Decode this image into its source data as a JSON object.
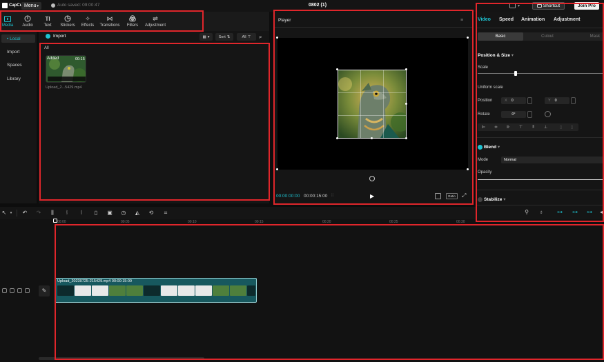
{
  "titlebar": {
    "logo": "CapCut",
    "menu_label": "Menu",
    "autosave": "Auto saved: 09:00:47",
    "project_title": "0802 (1)",
    "shortcut_label": "Shortcut",
    "join_pro_label": "Join Pro"
  },
  "toolbar": {
    "tools": [
      {
        "label": "Media",
        "icon": "media-icon"
      },
      {
        "label": "Audio",
        "icon": "audio-icon"
      },
      {
        "label": "Text",
        "icon": "text-icon"
      },
      {
        "label": "Stickers",
        "icon": "stickers-icon"
      },
      {
        "label": "Effects",
        "icon": "effects-icon"
      },
      {
        "label": "Transitions",
        "icon": "transitions-icon"
      },
      {
        "label": "Filters",
        "icon": "filters-icon"
      },
      {
        "label": "Adjustment",
        "icon": "adjustment-icon"
      }
    ]
  },
  "sidebar": {
    "items": [
      {
        "label": "• Local"
      },
      {
        "label": "Import"
      },
      {
        "label": "Spaces"
      },
      {
        "label": "Library"
      }
    ]
  },
  "media": {
    "import_label": "Import",
    "sort_label": "Sort",
    "all_filter": "All",
    "all_label": "All",
    "item": {
      "badge": "Added",
      "duration": "00:15",
      "name": "Upload_2...5429.mp4"
    }
  },
  "player": {
    "title": "Player",
    "current_time": "00:00:00:00",
    "total_time": "00:00:15:00",
    "ratio_label": "Ratio"
  },
  "inspector": {
    "tabs": [
      "Video",
      "Speed",
      "Animation",
      "Adjustment"
    ],
    "subtabs": [
      "Basic",
      "Cutout",
      "Mask"
    ],
    "position_size_title": "Position & Size",
    "scale_label": "Scale",
    "scale_value_fraction": 0.3,
    "uniform_scale_label": "Uniform scale",
    "position_label": "Position",
    "position_x_axis": "X",
    "position_x": "0",
    "position_y_axis": "Y",
    "position_y": "0",
    "rotate_label": "Rotate",
    "rotate_value": "0°",
    "blend_title": "Blend",
    "mode_label": "Mode",
    "mode_value": "Normal",
    "opacity_label": "Opacity",
    "stabilize_title": "Stabilize"
  },
  "timeline": {
    "ticks": [
      "00:00",
      "00:05",
      "00:10",
      "00:15",
      "00:20",
      "00:25",
      "00:30"
    ],
    "clip_label": "Upload_20230725-215429.mp4  00:00:15:00"
  },
  "colors": {
    "accent": "#1ec4d2",
    "highlight": "#e0262b"
  }
}
